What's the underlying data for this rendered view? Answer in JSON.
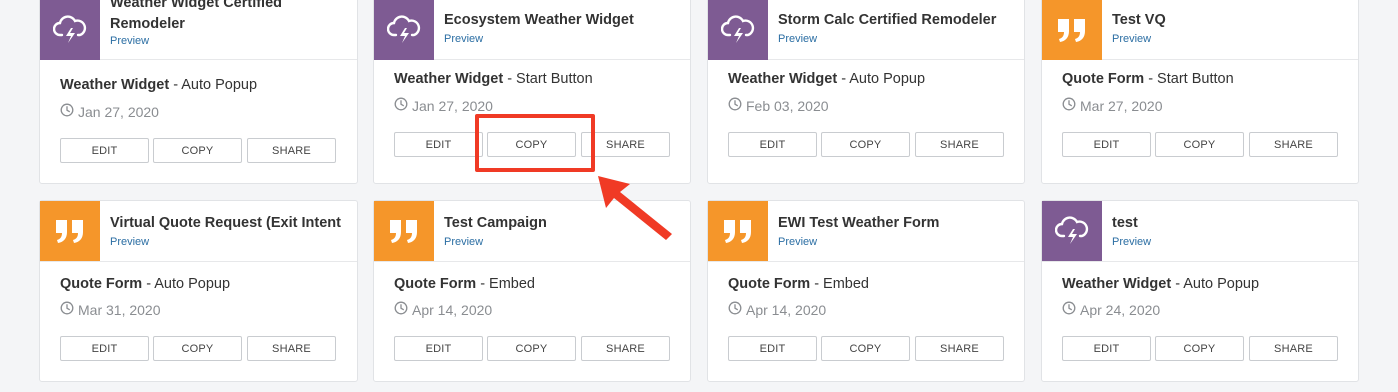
{
  "cards": [
    {
      "title": "Weather Widget Certified Remodeler",
      "preview": "Preview",
      "type": "Weather Widget",
      "mode": " - Auto Popup",
      "date": "Jan 27, 2020",
      "icon": "cloud-lightning-icon",
      "color": "#7e5b93"
    },
    {
      "title": "Ecosystem Weather Widget",
      "preview": "Preview",
      "type": "Weather Widget",
      "mode": " - Start Button",
      "date": "Jan 27, 2020",
      "icon": "cloud-lightning-icon",
      "color": "#7e5b93"
    },
    {
      "title": "Storm Calc Certified Remodeler",
      "preview": "Preview",
      "type": "Weather Widget",
      "mode": " - Auto Popup",
      "date": "Feb 03, 2020",
      "icon": "cloud-lightning-icon",
      "color": "#7e5b93"
    },
    {
      "title": "Test VQ",
      "preview": "Preview",
      "type": "Quote Form",
      "mode": " - Start Button",
      "date": "Mar 27, 2020",
      "icon": "quote-icon",
      "color": "#f5962a"
    },
    {
      "title": "Virtual Quote Request (Exit Intent",
      "preview": "Preview",
      "type": "Quote Form",
      "mode": " - Auto Popup",
      "date": "Mar 31, 2020",
      "icon": "quote-icon",
      "color": "#f5962a"
    },
    {
      "title": "Test Campaign",
      "preview": "Preview",
      "type": "Quote Form",
      "mode": " - Embed",
      "date": "Apr 14, 2020",
      "icon": "quote-icon",
      "color": "#f5962a"
    },
    {
      "title": "EWI Test Weather Form",
      "preview": "Preview",
      "type": "Quote Form",
      "mode": " - Embed",
      "date": "Apr 14, 2020",
      "icon": "quote-icon",
      "color": "#f5962a"
    },
    {
      "title": "test",
      "preview": "Preview",
      "type": "Weather Widget",
      "mode": " - Auto Popup",
      "date": "Apr 24, 2020",
      "icon": "cloud-lightning-icon",
      "color": "#7e5b93"
    }
  ],
  "buttons": {
    "edit": "EDIT",
    "copy": "COPY",
    "share": "SHARE"
  },
  "annotation": {
    "highlight_color": "#f03a25"
  }
}
